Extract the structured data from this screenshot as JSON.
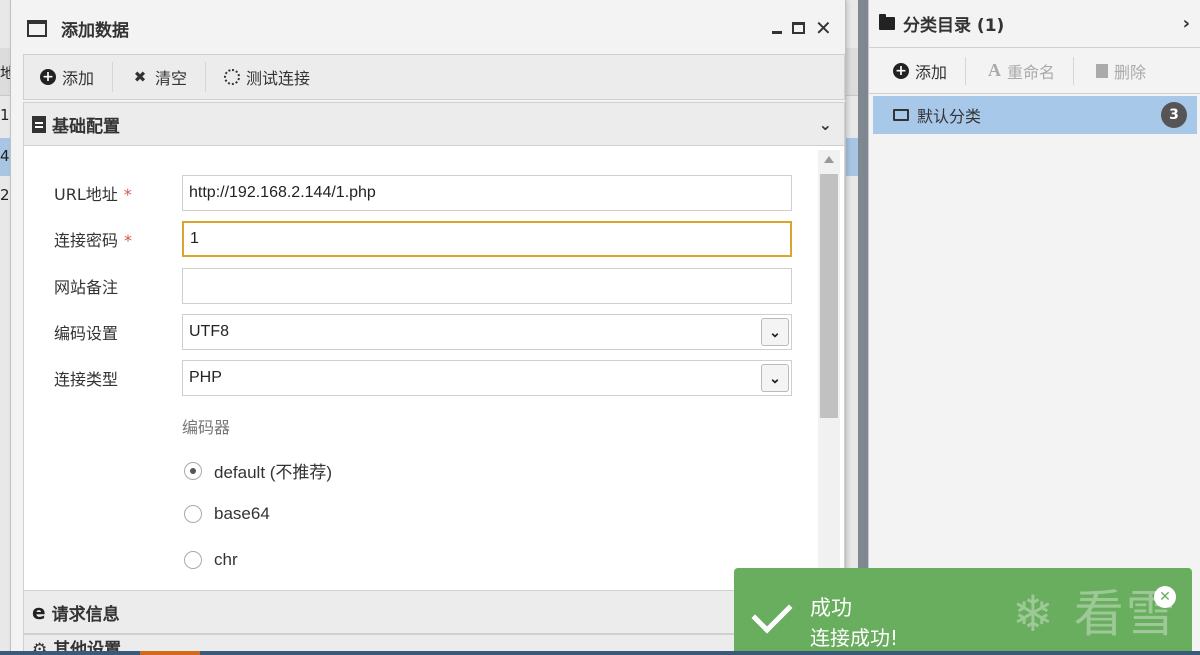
{
  "background": {
    "row_digits": [
      "1",
      "4",
      "2"
    ],
    "header_fragment": "地"
  },
  "modal": {
    "title": "添加数据",
    "window_controls": {
      "minimize": "_",
      "maximize": "□",
      "close": "✕"
    },
    "toolbar": {
      "add": "添加",
      "clear": "清空",
      "test_connection": "测试连接"
    },
    "sections": {
      "basic": "基础配置",
      "request": "请求信息",
      "other": "其他设置"
    },
    "form": {
      "url_label": "URL地址",
      "url_value": "http://192.168.2.144/1.php",
      "password_label": "连接密码",
      "password_value": "1",
      "note_label": "网站备注",
      "note_value": "",
      "encoding_label": "编码设置",
      "encoding_value": "UTF8",
      "type_label": "连接类型",
      "type_value": "PHP",
      "required_mark": "*",
      "encoder_title": "编码器",
      "encoders": [
        {
          "label": "default (不推荐)",
          "selected": true
        },
        {
          "label": "base64",
          "selected": false
        },
        {
          "label": "chr",
          "selected": false
        }
      ]
    }
  },
  "category_panel": {
    "title": "分类目录 (1)",
    "toolbar": {
      "add": "添加",
      "rename": "重命名",
      "delete": "删除"
    },
    "items": [
      {
        "label": "默认分类",
        "count": "3"
      }
    ]
  },
  "toast": {
    "title": "成功",
    "message": "连接成功!",
    "watermark": "❄ 看雪",
    "color": "#69ad5f"
  },
  "colors": {
    "selection": "#a8c8ea",
    "focus_border": "#d9a52e",
    "required": "#d9534f"
  }
}
